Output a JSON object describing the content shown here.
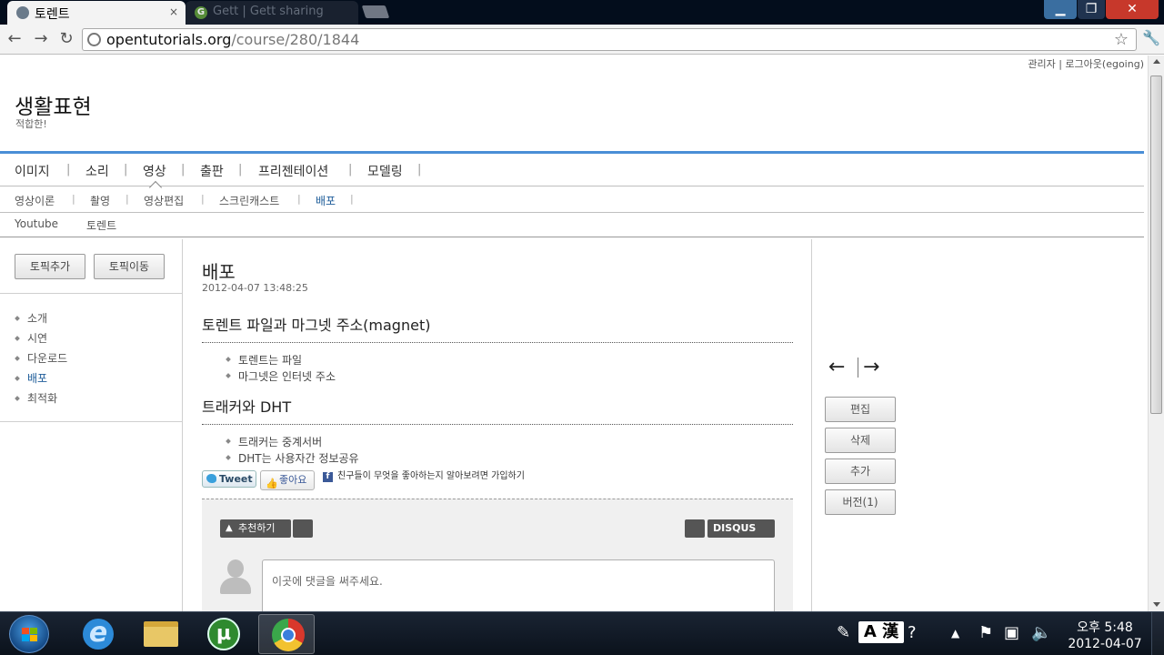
{
  "browser": {
    "tabs": [
      {
        "title": "토렌트",
        "active": true
      },
      {
        "title": "Gett | Gett sharing",
        "active": false
      }
    ],
    "tab_close": "×",
    "url_host": "opentutorials.org",
    "url_path": "/course/280/1844",
    "window_controls": {
      "minimize": "▁",
      "maximize": "❐",
      "close": "✕"
    },
    "nav": {
      "back": "←",
      "forward": "→",
      "reload": "↻"
    }
  },
  "header": {
    "links": "관리자 | 로그아웃(egoing)",
    "site_title": "생활표현",
    "site_subtitle": "적합한!"
  },
  "menu1": [
    "이미지",
    "소리",
    "영상",
    "출판",
    "프리젠테이션",
    "모델링"
  ],
  "menu2": [
    "영상이론",
    "촬영",
    "영상편집",
    "스크린캐스트",
    "배포"
  ],
  "menu2_active": "배포",
  "menu3": [
    "Youtube",
    "토렌트"
  ],
  "sidebar": {
    "buttons": [
      "토픽추가",
      "토픽이동"
    ],
    "topics": [
      "소개",
      "시연",
      "다운로드",
      "배포",
      "최적화"
    ],
    "active_topic": "배포"
  },
  "content": {
    "title": "배포",
    "date": "2012-04-07 13:48:25",
    "section1": {
      "heading": "토렌트 파일과 마그넷 주소(magnet)",
      "items": [
        "토렌트는 파일",
        "마그넷은 인터넷 주소"
      ]
    },
    "section2": {
      "heading": "트래커와 DHT",
      "items": [
        "트래커는 중계서버",
        "DHT는 사용자간 정보공유"
      ]
    },
    "social": {
      "tweet": "Tweet",
      "like": "좋아요",
      "fb_text": "친구들이 무엇을 좋아하는지 알아보려면 가입하기"
    },
    "disqus": {
      "recommend": "추천하기",
      "logo": "DISQUS",
      "placeholder": "이곳에 댓글을 써주세요."
    }
  },
  "rightcol": {
    "prev_arrow": "←",
    "next_arrow": "→",
    "buttons": [
      "편집",
      "삭제",
      "추가",
      "버전(1)"
    ]
  },
  "taskbar": {
    "lang_indicator": "A 漢",
    "clock_time": "오후 5:48",
    "clock_date": "2012-04-07"
  },
  "colors": {
    "accent_blue": "#4a8ed6",
    "active_link": "#1e5c99",
    "close_red": "#c7382b",
    "taskbar": "#0b121c"
  }
}
